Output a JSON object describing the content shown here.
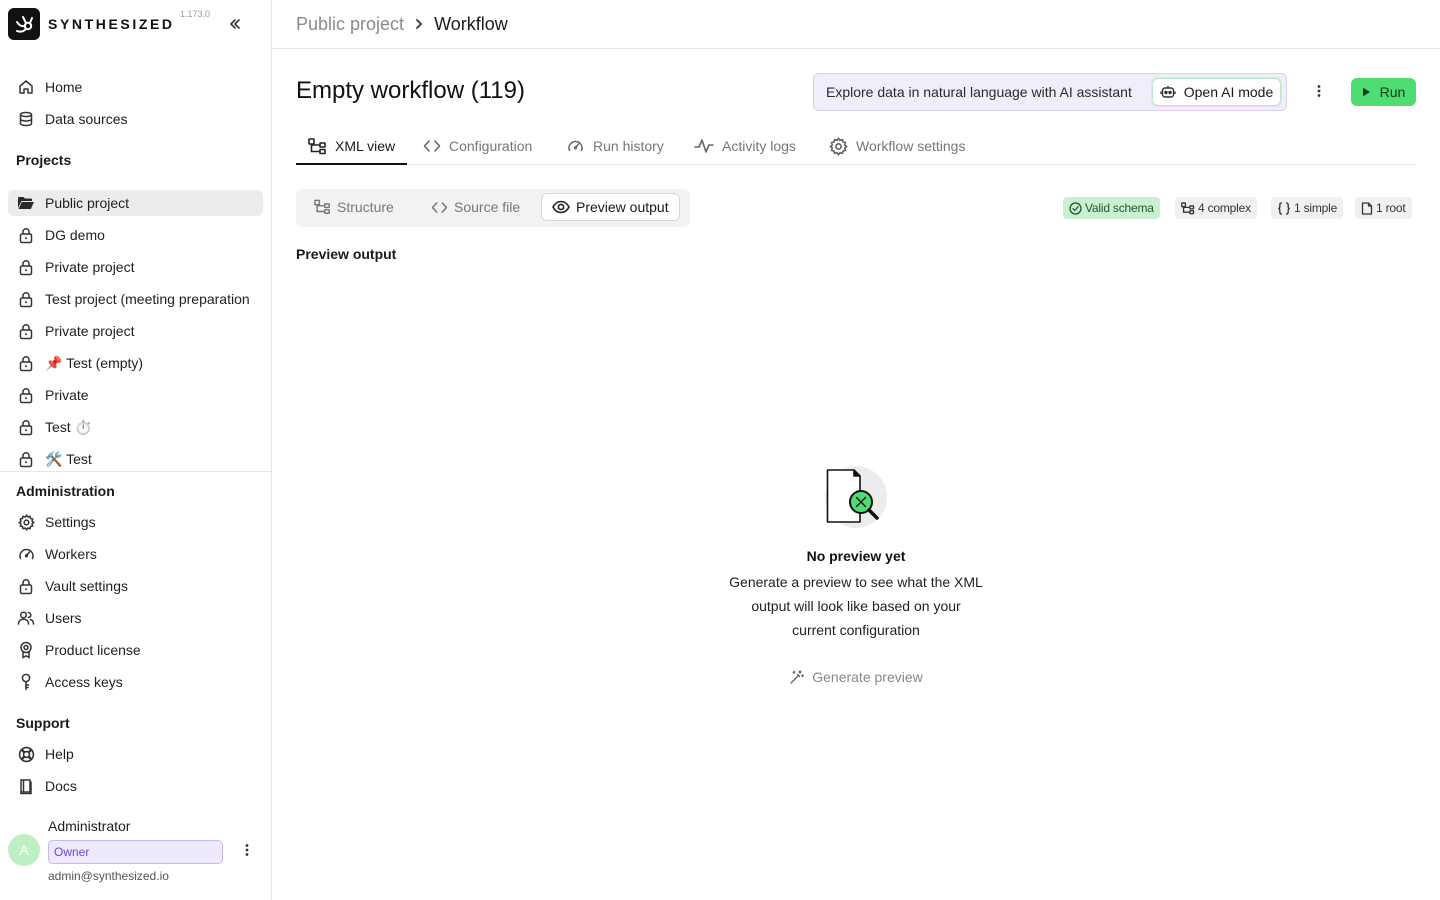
{
  "app": {
    "brand": "SYNTHESIZED",
    "version": "1.173.0"
  },
  "sidebar": {
    "nav": [
      {
        "label": "Home",
        "icon": "home-icon"
      },
      {
        "label": "Data sources",
        "icon": "database-icon"
      }
    ],
    "projects_title": "Projects",
    "projects": [
      {
        "label": "Public project",
        "icon": "folder-open-icon",
        "active": true
      },
      {
        "label": "DG demo",
        "icon": "lock-icon"
      },
      {
        "label": "Private project",
        "icon": "lock-icon"
      },
      {
        "label": "Test project (meeting preparation",
        "icon": "lock-icon"
      },
      {
        "label": "Private project",
        "icon": "lock-icon"
      },
      {
        "label": "📌 Test (empty)",
        "icon": "lock-icon"
      },
      {
        "label": "Private",
        "icon": "lock-icon"
      },
      {
        "label": "Test ⏱️",
        "icon": "lock-icon"
      },
      {
        "label": "🛠️ Test",
        "icon": "lock-icon"
      }
    ],
    "admin_title": "Administration",
    "admin": [
      {
        "label": "Settings",
        "icon": "gear-icon"
      },
      {
        "label": "Workers",
        "icon": "gauge-icon"
      },
      {
        "label": "Vault settings",
        "icon": "lock-icon"
      },
      {
        "label": "Users",
        "icon": "users-icon"
      },
      {
        "label": "Product license",
        "icon": "award-icon"
      },
      {
        "label": "Access keys",
        "icon": "key-icon"
      }
    ],
    "support_title": "Support",
    "support": [
      {
        "label": "Help",
        "icon": "lifebuoy-icon"
      },
      {
        "label": "Docs",
        "icon": "book-icon"
      }
    ],
    "user": {
      "initial": "A",
      "name": "Administrator",
      "role": "Owner",
      "email": "admin@synthesized.io"
    }
  },
  "breadcrumb": {
    "parent": "Public project",
    "current": "Workflow"
  },
  "header": {
    "title": "Empty workflow (119)",
    "ai_banner_text": "Explore data in natural language with AI assistant",
    "ai_button": "Open AI mode",
    "run_button": "Run"
  },
  "tabs": [
    {
      "label": "XML view",
      "icon": "schema-icon",
      "active": true
    },
    {
      "label": "Configuration",
      "icon": "code-icon"
    },
    {
      "label": "Run history",
      "icon": "gauge-icon"
    },
    {
      "label": "Activity logs",
      "icon": "activity-icon"
    },
    {
      "label": "Workflow settings",
      "icon": "gear-icon"
    }
  ],
  "view_toggle": [
    {
      "label": "Structure",
      "icon": "schema-icon"
    },
    {
      "label": "Source file",
      "icon": "code-icon"
    },
    {
      "label": "Preview output",
      "icon": "eye-icon",
      "active": true
    }
  ],
  "schema_stats": {
    "valid": "Valid schema",
    "complex": "4 complex",
    "simple": "1 simple",
    "root": "1 root"
  },
  "preview": {
    "section_label": "Preview output",
    "empty_title": "No preview yet",
    "empty_description": "Generate a preview to see what the XML output will look like based on your current configuration",
    "generate_button": "Generate preview"
  },
  "colors": {
    "accent_green": "#4fdc73",
    "ai_banner_bg": "#f1eefb",
    "owner_badge": "#6b46d6"
  }
}
